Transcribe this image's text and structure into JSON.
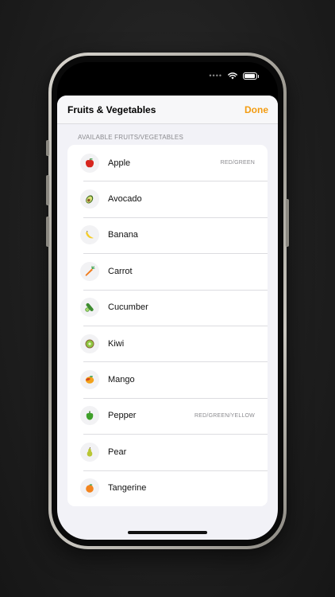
{
  "header": {
    "title": "Fruits & Vegetables",
    "done_label": "Done"
  },
  "section": {
    "title": "AVAILABLE FRUITS/VEGETABLES"
  },
  "colors": {
    "accent": "#f39c12",
    "background": "#f2f2f7"
  },
  "items": [
    {
      "label": "Apple",
      "detail": "RED/GREEN",
      "icon": "apple-icon"
    },
    {
      "label": "Avocado",
      "detail": "",
      "icon": "avocado-icon"
    },
    {
      "label": "Banana",
      "detail": "",
      "icon": "banana-icon"
    },
    {
      "label": "Carrot",
      "detail": "",
      "icon": "carrot-icon"
    },
    {
      "label": "Cucumber",
      "detail": "",
      "icon": "cucumber-icon"
    },
    {
      "label": "Kiwi",
      "detail": "",
      "icon": "kiwi-icon"
    },
    {
      "label": "Mango",
      "detail": "",
      "icon": "mango-icon"
    },
    {
      "label": "Pepper",
      "detail": "RED/GREEN/YELLOW",
      "icon": "pepper-icon"
    },
    {
      "label": "Pear",
      "detail": "",
      "icon": "pear-icon"
    },
    {
      "label": "Tangerine",
      "detail": "",
      "icon": "tangerine-icon"
    }
  ]
}
